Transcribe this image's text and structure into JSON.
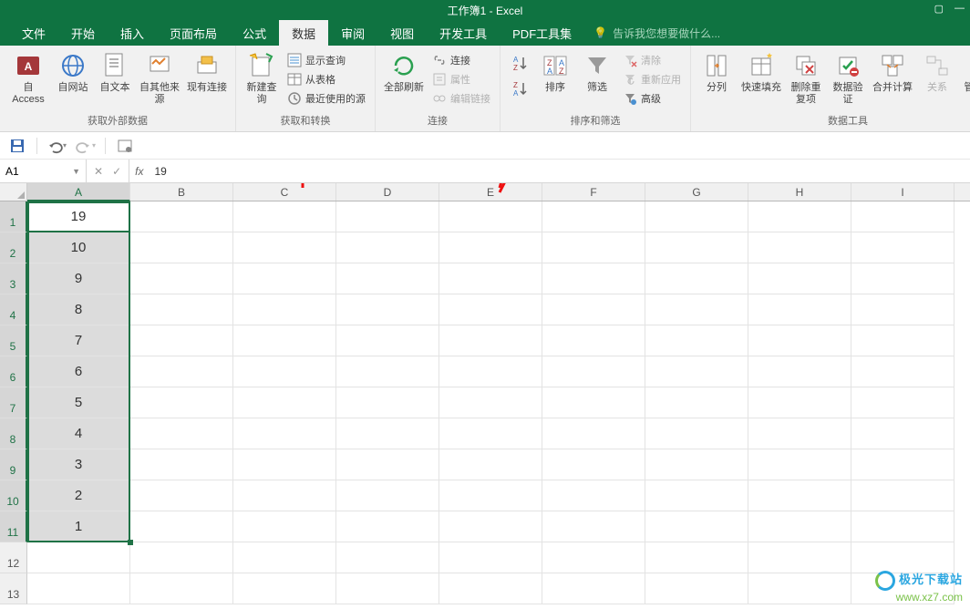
{
  "app": {
    "title": "工作簿1 - Excel"
  },
  "tabs": {
    "file": "文件",
    "home": "开始",
    "insert": "插入",
    "layout": "页面布局",
    "formulas": "公式",
    "data": "数据",
    "review": "审阅",
    "view": "视图",
    "dev": "开发工具",
    "pdf": "PDF工具集",
    "tell_me": "告诉我您想要做什么..."
  },
  "ribbon": {
    "ext_data": {
      "access": "自 Access",
      "web": "自网站",
      "text": "自文本",
      "other": "自其他来源",
      "existing": "现有连接",
      "label": "获取外部数据"
    },
    "get_transform": {
      "new_query": "新建查询",
      "show_query": "显示查询",
      "from_table": "从表格",
      "recent": "最近使用的源",
      "label": "获取和转换"
    },
    "connections": {
      "refresh_all": "全部刷新",
      "conn": "连接",
      "props": "属性",
      "edit_links": "编辑链接",
      "label": "连接"
    },
    "sort_filter": {
      "sort_asc": "升序",
      "sort_desc": "降序",
      "sort": "排序",
      "filter": "筛选",
      "clear": "清除",
      "reapply": "重新应用",
      "advanced": "高级",
      "label": "排序和筛选"
    },
    "data_tools": {
      "text_to_cols": "分列",
      "flash_fill": "快速填充",
      "remove_dup": "删除重复项",
      "data_val": "数据验证",
      "consolidate": "合并计算",
      "relationships": "关系",
      "manage": "管理数据",
      "label": "数据工具"
    }
  },
  "formula_bar": {
    "name_box": "A1",
    "value": "19"
  },
  "columns": [
    "A",
    "B",
    "C",
    "D",
    "E",
    "F",
    "G",
    "H",
    "I"
  ],
  "rows_data": [
    "19",
    "10",
    "9",
    "8",
    "7",
    "6",
    "5",
    "4",
    "3",
    "2",
    "1"
  ],
  "watermark": {
    "line1": "极光下载站",
    "line2": "www.xz7.com"
  }
}
